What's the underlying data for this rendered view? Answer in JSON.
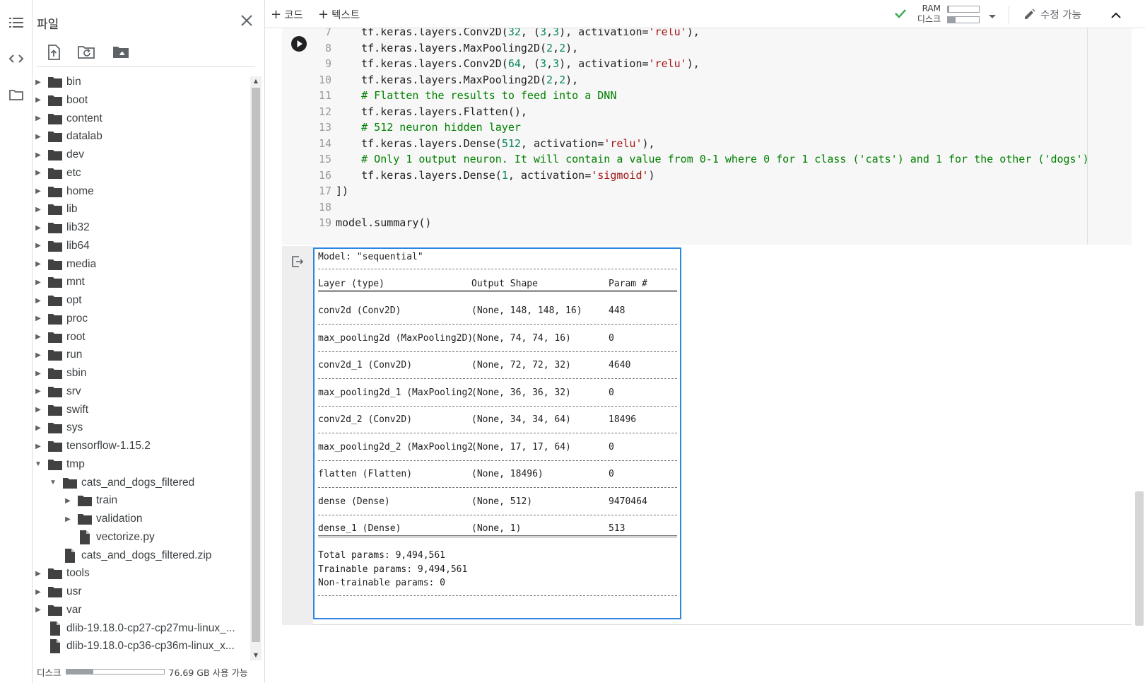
{
  "files_panel": {
    "title": "파일",
    "tree": [
      {
        "name": "bin",
        "type": "folder",
        "depth": 0,
        "expanded": false
      },
      {
        "name": "boot",
        "type": "folder",
        "depth": 0,
        "expanded": false
      },
      {
        "name": "content",
        "type": "folder",
        "depth": 0,
        "expanded": false
      },
      {
        "name": "datalab",
        "type": "folder",
        "depth": 0,
        "expanded": false
      },
      {
        "name": "dev",
        "type": "folder",
        "depth": 0,
        "expanded": false
      },
      {
        "name": "etc",
        "type": "folder",
        "depth": 0,
        "expanded": false
      },
      {
        "name": "home",
        "type": "folder",
        "depth": 0,
        "expanded": false
      },
      {
        "name": "lib",
        "type": "folder",
        "depth": 0,
        "expanded": false
      },
      {
        "name": "lib32",
        "type": "folder",
        "depth": 0,
        "expanded": false
      },
      {
        "name": "lib64",
        "type": "folder",
        "depth": 0,
        "expanded": false
      },
      {
        "name": "media",
        "type": "folder",
        "depth": 0,
        "expanded": false
      },
      {
        "name": "mnt",
        "type": "folder",
        "depth": 0,
        "expanded": false
      },
      {
        "name": "opt",
        "type": "folder",
        "depth": 0,
        "expanded": false
      },
      {
        "name": "proc",
        "type": "folder",
        "depth": 0,
        "expanded": false
      },
      {
        "name": "root",
        "type": "folder",
        "depth": 0,
        "expanded": false
      },
      {
        "name": "run",
        "type": "folder",
        "depth": 0,
        "expanded": false
      },
      {
        "name": "sbin",
        "type": "folder",
        "depth": 0,
        "expanded": false
      },
      {
        "name": "srv",
        "type": "folder",
        "depth": 0,
        "expanded": false
      },
      {
        "name": "swift",
        "type": "folder",
        "depth": 0,
        "expanded": false
      },
      {
        "name": "sys",
        "type": "folder",
        "depth": 0,
        "expanded": false
      },
      {
        "name": "tensorflow-1.15.2",
        "type": "folder",
        "depth": 0,
        "expanded": false
      },
      {
        "name": "tmp",
        "type": "folder",
        "depth": 0,
        "expanded": true
      },
      {
        "name": "cats_and_dogs_filtered",
        "type": "folder",
        "depth": 1,
        "expanded": true
      },
      {
        "name": "train",
        "type": "folder",
        "depth": 2,
        "expanded": false
      },
      {
        "name": "validation",
        "type": "folder",
        "depth": 2,
        "expanded": false
      },
      {
        "name": "vectorize.py",
        "type": "file",
        "depth": 2
      },
      {
        "name": "cats_and_dogs_filtered.zip",
        "type": "file",
        "depth": 1
      },
      {
        "name": "tools",
        "type": "folder",
        "depth": 0,
        "expanded": false
      },
      {
        "name": "usr",
        "type": "folder",
        "depth": 0,
        "expanded": false
      },
      {
        "name": "var",
        "type": "folder",
        "depth": 0,
        "expanded": false
      },
      {
        "name": "dlib-19.18.0-cp27-cp27mu-linux_...",
        "type": "file",
        "depth": 0
      },
      {
        "name": "dlib-19.18.0-cp36-cp36m-linux_x...",
        "type": "file",
        "depth": 0
      }
    ],
    "disk_label": "디스크",
    "disk_usage_fraction": 0.28,
    "disk_free_text": "76.69 GB 사용 가능"
  },
  "toolbar": {
    "add_code_label": "코드",
    "add_text_label": "텍스트",
    "ram_label": "RAM",
    "disk_label": "디스크",
    "ram_fraction": 0.05,
    "disk_fraction": 0.25,
    "edit_mode_label": "수정 가능",
    "status_color": "#34a853"
  },
  "code_cell": {
    "lines": [
      {
        "n": "7",
        "segments": [
          {
            "t": "    tf.keras.layers.Conv2D("
          },
          {
            "t": "32",
            "c": "num"
          },
          {
            "t": ", ("
          },
          {
            "t": "3",
            "c": "num"
          },
          {
            "t": ","
          },
          {
            "t": "3",
            "c": "num"
          },
          {
            "t": "), activation="
          },
          {
            "t": "'relu'",
            "c": "str"
          },
          {
            "t": "),"
          }
        ]
      },
      {
        "n": "8",
        "segments": [
          {
            "t": "    tf.keras.layers.MaxPooling2D("
          },
          {
            "t": "2",
            "c": "num"
          },
          {
            "t": ","
          },
          {
            "t": "2",
            "c": "num"
          },
          {
            "t": "),"
          }
        ]
      },
      {
        "n": "9",
        "segments": [
          {
            "t": "    tf.keras.layers.Conv2D("
          },
          {
            "t": "64",
            "c": "num"
          },
          {
            "t": ", ("
          },
          {
            "t": "3",
            "c": "num"
          },
          {
            "t": ","
          },
          {
            "t": "3",
            "c": "num"
          },
          {
            "t": "), activation="
          },
          {
            "t": "'relu'",
            "c": "str"
          },
          {
            "t": "),"
          }
        ]
      },
      {
        "n": "10",
        "segments": [
          {
            "t": "    tf.keras.layers.MaxPooling2D("
          },
          {
            "t": "2",
            "c": "num"
          },
          {
            "t": ","
          },
          {
            "t": "2",
            "c": "num"
          },
          {
            "t": "),"
          }
        ]
      },
      {
        "n": "11",
        "segments": [
          {
            "t": "    "
          },
          {
            "t": "# Flatten the results to feed into a DNN",
            "c": "cm"
          }
        ]
      },
      {
        "n": "12",
        "segments": [
          {
            "t": "    tf.keras.layers.Flatten(),"
          }
        ]
      },
      {
        "n": "13",
        "segments": [
          {
            "t": "    "
          },
          {
            "t": "# 512 neuron hidden layer",
            "c": "cm"
          }
        ]
      },
      {
        "n": "14",
        "segments": [
          {
            "t": "    tf.keras.layers.Dense("
          },
          {
            "t": "512",
            "c": "num"
          },
          {
            "t": ", activation="
          },
          {
            "t": "'relu'",
            "c": "str"
          },
          {
            "t": "),"
          }
        ]
      },
      {
        "n": "15",
        "segments": [
          {
            "t": "    "
          },
          {
            "t": "# Only 1 output neuron. It will contain a value from 0-1 where 0 for 1 class ('cats') and 1 for the other ('dogs')",
            "c": "cm"
          }
        ]
      },
      {
        "n": "16",
        "segments": [
          {
            "t": "    tf.keras.layers.Dense("
          },
          {
            "t": "1",
            "c": "num"
          },
          {
            "t": ", activation="
          },
          {
            "t": "'sigmoid'",
            "c": "str"
          },
          {
            "t": ")"
          }
        ]
      },
      {
        "n": "17",
        "segments": [
          {
            "t": "])"
          }
        ]
      },
      {
        "n": "18",
        "segments": [
          {
            "t": ""
          }
        ]
      },
      {
        "n": "19",
        "segments": [
          {
            "t": "model.summary()"
          }
        ]
      }
    ]
  },
  "output": {
    "model_title": "Model: \"sequential\"",
    "headers": {
      "layer": "Layer (type)",
      "shape": "Output Shape",
      "params": "Param #"
    },
    "rows": [
      {
        "layer": "conv2d (Conv2D)",
        "shape": "(None, 148, 148, 16)",
        "params": "448"
      },
      {
        "layer": "max_pooling2d (MaxPooling2D)",
        "shape": "(None, 74, 74, 16)",
        "params": "0"
      },
      {
        "layer": "conv2d_1 (Conv2D)",
        "shape": "(None, 72, 72, 32)",
        "params": "4640"
      },
      {
        "layer": "max_pooling2d_1 (MaxPooling2",
        "shape": "(None, 36, 36, 32)",
        "params": "0"
      },
      {
        "layer": "conv2d_2 (Conv2D)",
        "shape": "(None, 34, 34, 64)",
        "params": "18496"
      },
      {
        "layer": "max_pooling2d_2 (MaxPooling2",
        "shape": "(None, 17, 17, 64)",
        "params": "0"
      },
      {
        "layer": "flatten (Flatten)",
        "shape": "(None, 18496)",
        "params": "0"
      },
      {
        "layer": "dense (Dense)",
        "shape": "(None, 512)",
        "params": "9470464"
      },
      {
        "layer": "dense_1 (Dense)",
        "shape": "(None, 1)",
        "params": "513"
      }
    ],
    "total_params": "Total params: 9,494,561",
    "trainable_params": "Trainable params: 9,494,561",
    "non_trainable_params": "Non-trainable params: 0"
  },
  "colors": {
    "accent": "#2e86de",
    "number": "#098658",
    "string": "#a31515",
    "comment": "#008000"
  }
}
